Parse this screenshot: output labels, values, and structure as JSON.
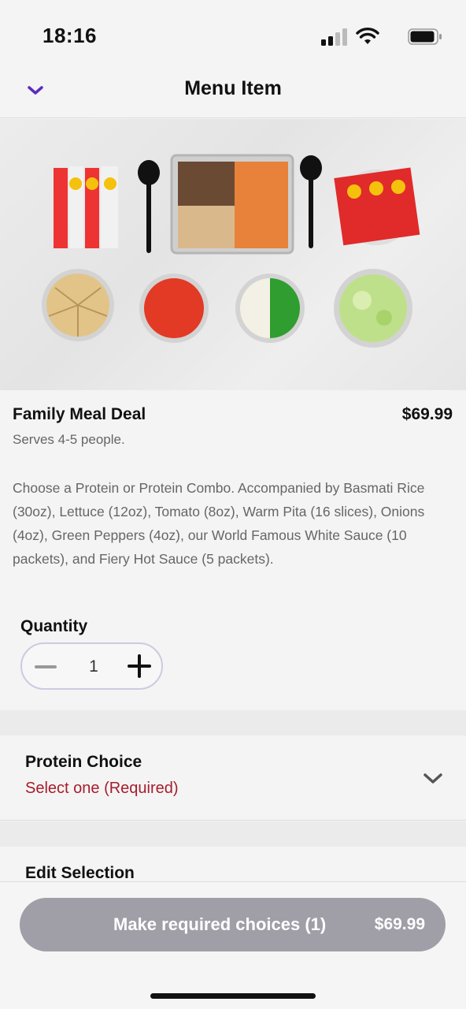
{
  "status_bar": {
    "time": "18:16",
    "icons": [
      "signal-icon",
      "wifi-icon",
      "battery-icon"
    ]
  },
  "nav": {
    "title": "Menu Item",
    "back_icon": "chevron-down-icon"
  },
  "item": {
    "name": "Family Meal Deal",
    "price": "$69.99",
    "serves": "Serves 4-5 people.",
    "description": "Choose a Protein or Protein Combo. Accompanied by Basmati Rice (30oz), Lettuce (12oz), Tomato (8oz), Warm Pita (16 slices), Onions (4oz), Green Peppers (4oz), our World Famous White Sauce (10 packets), and Fiery Hot Sauce (5 packets)."
  },
  "quantity": {
    "label": "Quantity",
    "value": "1",
    "minus_icon": "minus-icon",
    "plus_icon": "plus-icon"
  },
  "options": [
    {
      "title": "Protein Choice",
      "requirement": "Select one (Required)",
      "icon": "chevron-down-icon"
    },
    {
      "title": "Edit Selection"
    }
  ],
  "cta": {
    "label": "Make required choices (1)",
    "price": "$69.99"
  },
  "colors": {
    "accent": "#5a2dbf",
    "required": "#a51d2d",
    "cta_disabled": "#a09fa8"
  }
}
